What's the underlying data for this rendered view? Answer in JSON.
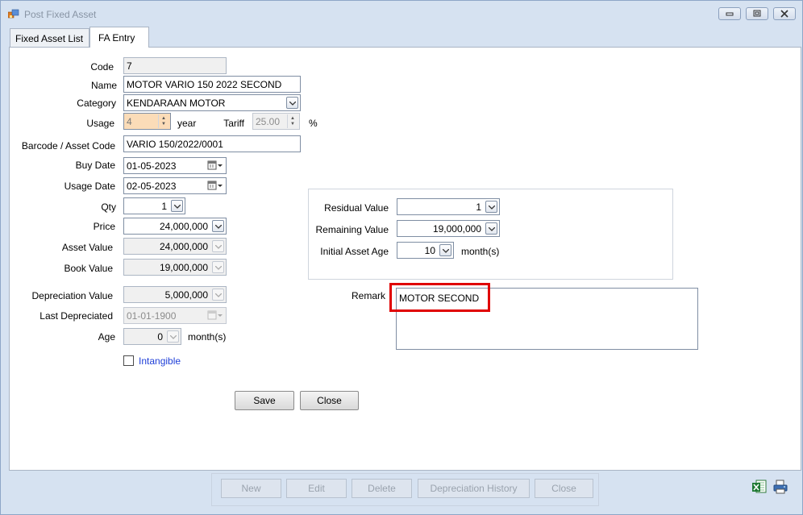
{
  "window": {
    "title": "Post Fixed Asset"
  },
  "tabs": [
    {
      "label": "Fixed Asset List"
    },
    {
      "label": "FA Entry"
    }
  ],
  "form": {
    "code": {
      "label": "Code",
      "value": "7"
    },
    "name": {
      "label": "Name",
      "value": "MOTOR VARIO 150 2022 SECOND"
    },
    "category": {
      "label": "Category",
      "value": "KENDARAAN MOTOR"
    },
    "usage": {
      "label": "Usage",
      "value": "4",
      "unit": "year"
    },
    "tariff": {
      "label": "Tariff",
      "value": "25.00",
      "unit": "%"
    },
    "barcode": {
      "label": "Barcode / Asset Code",
      "value": "VARIO 150/2022/0001"
    },
    "buy_date": {
      "label": "Buy Date",
      "value": "01-05-2023"
    },
    "usage_date": {
      "label": "Usage Date",
      "value": "02-05-2023"
    },
    "qty": {
      "label": "Qty",
      "value": "1"
    },
    "price": {
      "label": "Price",
      "value": "24,000,000"
    },
    "asset_value": {
      "label": "Asset Value",
      "value": "24,000,000"
    },
    "book_value": {
      "label": "Book Value",
      "value": "19,000,000"
    },
    "depreciation_value": {
      "label": "Depreciation Value",
      "value": "5,000,000"
    },
    "last_depreciated": {
      "label": "Last Depreciated",
      "value": "01-01-1900"
    },
    "age": {
      "label": "Age",
      "value": "0",
      "unit": "month(s)"
    },
    "intangible": {
      "label": "Intangible",
      "checked": false
    },
    "residual_value": {
      "label": "Residual Value",
      "value": "1"
    },
    "remaining_value": {
      "label": "Remaining Value",
      "value": "19,000,000"
    },
    "initial_asset_age": {
      "label": "Initial Asset Age",
      "value": "10",
      "unit": "month(s)"
    },
    "remark": {
      "label": "Remark",
      "value": "MOTOR SECOND"
    }
  },
  "actions": {
    "save": "Save",
    "close": "Close"
  },
  "toolbar": {
    "new": "New",
    "edit": "Edit",
    "delete": "Delete",
    "depreciation_history": "Depreciation History",
    "close": "Close"
  },
  "icons": {
    "excel": "excel-export-icon",
    "print": "print-icon"
  },
  "colors": {
    "highlight": "#e00000",
    "link": "#1f3fd8",
    "readonly_peach": "#fbdcb8"
  }
}
